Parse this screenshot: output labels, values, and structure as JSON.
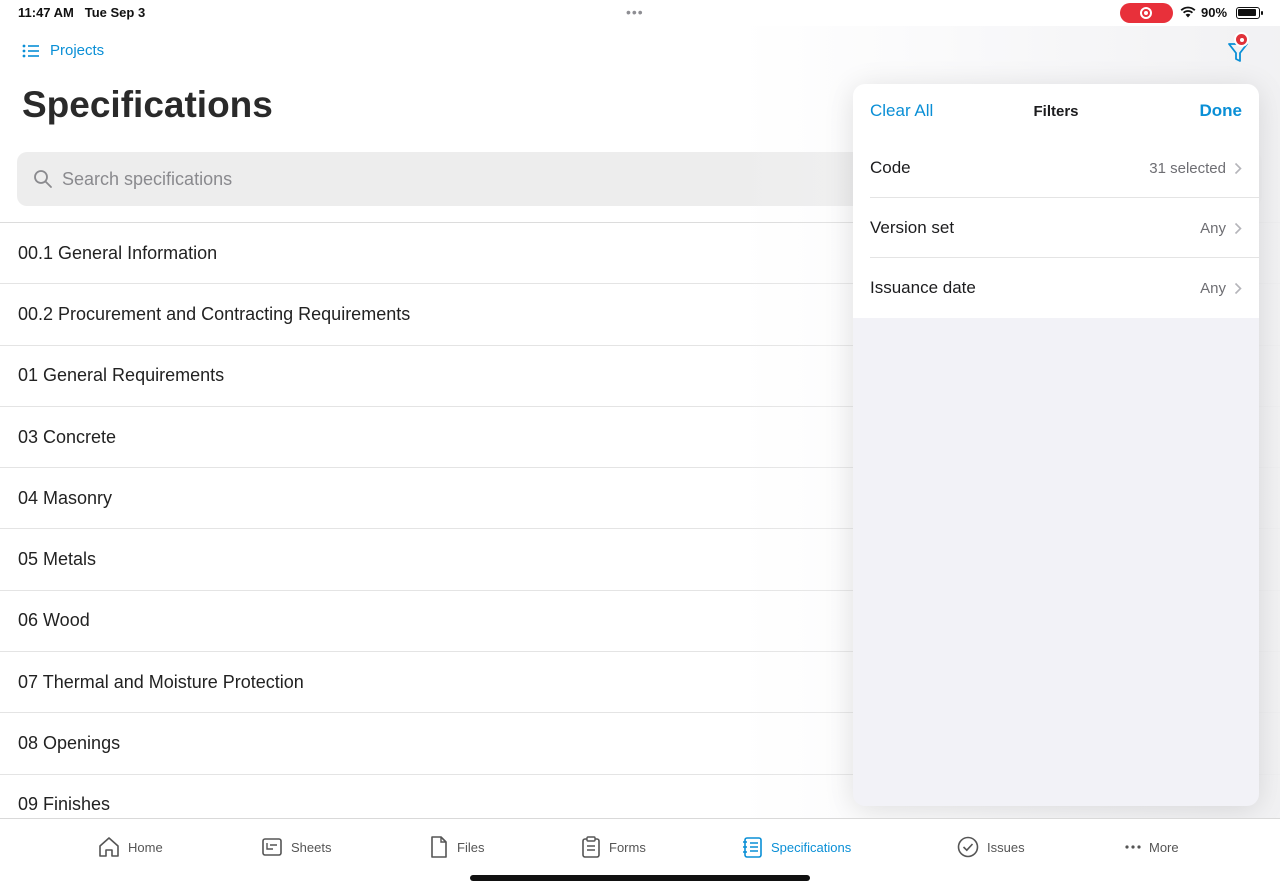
{
  "status_bar": {
    "time": "11:47 AM",
    "date": "Tue Sep 3",
    "dots": "•••",
    "battery_pct": "90%",
    "battery_level": 0.9,
    "recording_color": "#e8303a"
  },
  "nav": {
    "projects_label": "Projects",
    "projects_icon": "list-icon",
    "filter_icon": "filter-icon"
  },
  "page": {
    "title": "Specifications"
  },
  "search": {
    "placeholder": "Search specifications",
    "value": ""
  },
  "specs": [
    {
      "label": "00.1 General Information"
    },
    {
      "label": "00.2 Procurement and Contracting Requirements"
    },
    {
      "label": "01 General Requirements"
    },
    {
      "label": "03 Concrete"
    },
    {
      "label": "04 Masonry"
    },
    {
      "label": "05 Metals"
    },
    {
      "label": "06 Wood"
    },
    {
      "label": "07 Thermal and Moisture Protection"
    },
    {
      "label": "08 Openings"
    },
    {
      "label": "09 Finishes"
    }
  ],
  "filters_popover": {
    "clear_label": "Clear All",
    "title": "Filters",
    "done_label": "Done",
    "rows": [
      {
        "label": "Code",
        "value": "31 selected"
      },
      {
        "label": "Version set",
        "value": "Any"
      },
      {
        "label": "Issuance date",
        "value": "Any"
      }
    ]
  },
  "tabs": [
    {
      "label": "Home",
      "icon": "home-icon",
      "active": false
    },
    {
      "label": "Sheets",
      "icon": "sheets-icon",
      "active": false
    },
    {
      "label": "Files",
      "icon": "file-icon",
      "active": false
    },
    {
      "label": "Forms",
      "icon": "clipboard-icon",
      "active": false
    },
    {
      "label": "Specifications",
      "icon": "specifications-icon",
      "active": true
    },
    {
      "label": "Issues",
      "icon": "check-circle-icon",
      "active": false
    },
    {
      "label": "More",
      "icon": "more-icon",
      "active": false
    }
  ],
  "colors": {
    "accent": "#0a8fd6",
    "badge": "#e0323a"
  }
}
